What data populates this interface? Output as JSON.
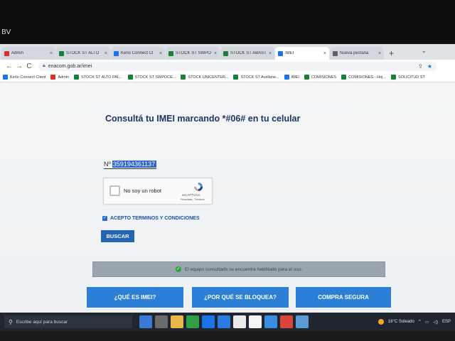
{
  "bezel": {
    "logo": "BV"
  },
  "browser": {
    "tabs": [
      {
        "label": "Admin",
        "color": "#d93025",
        "active": false
      },
      {
        "label": "STOCK ST ALTO",
        "color": "#188038",
        "active": false
      },
      {
        "label": "Kerio Connect Cl",
        "color": "#1a73e8",
        "active": false
      },
      {
        "label": "STOCK ST SWPO",
        "color": "#188038",
        "active": false
      },
      {
        "label": "STOCK ST ABAST",
        "color": "#188038",
        "active": false
      },
      {
        "label": "IMEI",
        "color": "#1a73e8",
        "active": true
      },
      {
        "label": "Nueva pestaña",
        "color": "#5f6368",
        "active": false
      }
    ],
    "new_tab": "+",
    "tab_close": "×",
    "window_menu": "⌄",
    "nav": {
      "back": "←",
      "forward": "→",
      "reload": "C"
    },
    "url": "enacom.gob.ar/imei",
    "bookmarks": [
      {
        "label": "Kerio Connect Client",
        "color": "#1a73e8"
      },
      {
        "label": "Admin",
        "color": "#d93025"
      },
      {
        "label": "STOCK ST ALTO PAL...",
        "color": "#188038"
      },
      {
        "label": "STOCK ST SWPOCE...",
        "color": "#188038"
      },
      {
        "label": "STOCK UNICENTER...",
        "color": "#188038"
      },
      {
        "label": "STOCK ST Avellane...",
        "color": "#188038"
      },
      {
        "label": "IMEI",
        "color": "#1a73e8"
      },
      {
        "label": "COMISIONES",
        "color": "#188038"
      },
      {
        "label": "COMISIONES - Hoj...",
        "color": "#188038"
      },
      {
        "label": "SOLICITUD ST",
        "color": "#188038"
      }
    ]
  },
  "page": {
    "title": "Consultá tu IMEI marcando *#06# en tu celular",
    "imei_prefix": "Nº",
    "imei_value": "359194361137",
    "captcha": {
      "label": "No soy un robot",
      "brand": "reCAPTCHA",
      "links": "Privacidad - Términos"
    },
    "terms_label": "ACEPTO TERMINOS Y CONDICIONES",
    "search_button": "BUSCAR",
    "status_message": "El equipo consultado se encuentra habilitado para el uso.",
    "buttons": {
      "what_is_imei": "¿QUÉ ES IMEI?",
      "why_blocked": "¿POR QUÉ SE BLOQUEA?",
      "safe_purchase": "COMPRA SEGURA"
    }
  },
  "taskbar": {
    "search_placeholder": "Escribe aquí para buscar",
    "weather": "18°C Soleado",
    "language": "ESP",
    "app_colors": [
      "#3c7bd5",
      "#6b6b6b",
      "#e8b64a",
      "#2f9e44",
      "#1a73e8",
      "#2c7be5",
      "#eaeaea",
      "#f4f4f4",
      "#3a8dde",
      "#d9453b",
      "#5b9bd5"
    ]
  }
}
